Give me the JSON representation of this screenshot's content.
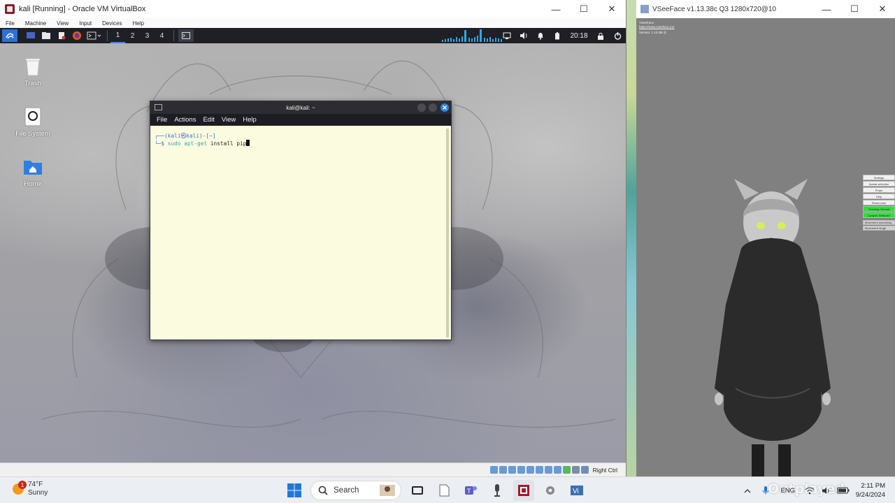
{
  "vbox": {
    "title": "kali [Running] - Oracle VM VirtualBox",
    "menu": [
      "File",
      "Machine",
      "View",
      "Input",
      "Devices",
      "Help"
    ],
    "window_controls": {
      "minimize": "—",
      "maximize": "☐",
      "close": "✕"
    },
    "status_host_key": "Right Ctrl"
  },
  "kali_panel": {
    "workspaces": [
      "1",
      "2",
      "3",
      "4"
    ],
    "active_workspace": "1",
    "clock": "20:18"
  },
  "desktop_icons": [
    {
      "label": "Trash",
      "icon": "trash-icon"
    },
    {
      "label": "File System",
      "icon": "drive-icon"
    },
    {
      "label": "Home",
      "icon": "home-folder-icon"
    }
  ],
  "terminal": {
    "title": "kali@kali: ~",
    "menu": [
      "File",
      "Actions",
      "Edit",
      "View",
      "Help"
    ],
    "prompt_line": "┌──(kali㉿kali)-[~]",
    "prompt_symbol": "└─$",
    "cmd_sudo": "sudo",
    "cmd_aptget": "apt-get",
    "cmd_args": "install pip"
  },
  "vseeface": {
    "title": "VSeeFace v1.13.38c Q3 1280x720@10",
    "info_name": "VSeeFace",
    "info_link": "https://www.vseeface.icu/",
    "info_version": "Version: 1.13.38c β",
    "menu": [
      "Settings",
      "Avatar selection",
      "Props",
      "Help",
      "Reset pose"
    ],
    "green_buttons": [
      "Tracking: Normal",
      "Lipsync: Webcam"
    ],
    "sliders": [
      "Movement smoothing",
      "Movement range"
    ],
    "window_controls": {
      "minimize": "—",
      "maximize": "☐",
      "close": "✕"
    }
  },
  "taskbar": {
    "weather_temp": "74°F",
    "weather_desc": "Sunny",
    "weather_badge": "1",
    "search_placeholder": "Search",
    "language": "ENG",
    "time": "2:11 PM",
    "date": "9/24/2024"
  },
  "watermark": "Outplayed",
  "colors": {
    "kali_blue": "#3a86ff",
    "terminal_bg": "#fbfbe0",
    "vsee_green": "#22e62e",
    "taskbar_bg": "#ebeef2"
  }
}
